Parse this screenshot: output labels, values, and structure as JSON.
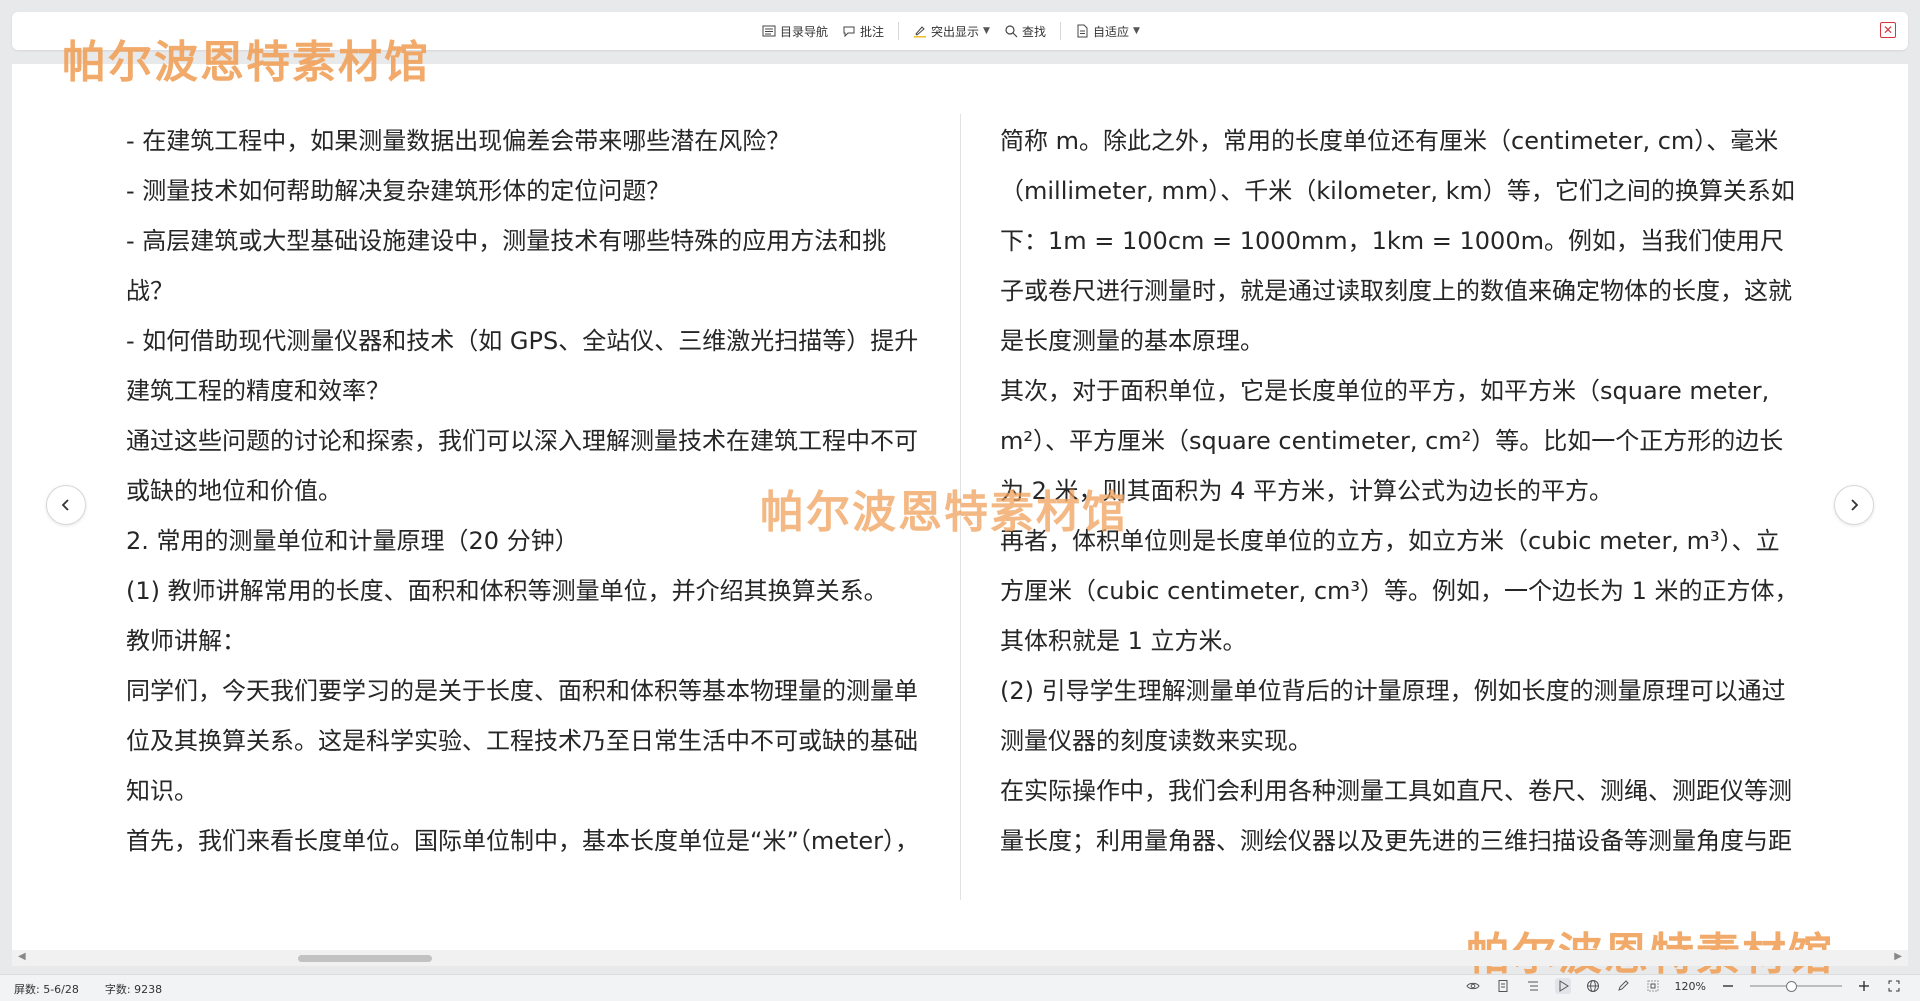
{
  "watermark": "帕尔波恩特素材馆",
  "toolbar": {
    "toc_label": "目录导航",
    "comment_label": "批注",
    "highlight_label": "突出显示",
    "find_label": "查找",
    "fit_label": "自适应"
  },
  "left_column": [
    "- 在建筑工程中，如果测量数据出现偏差会带来哪些潜在风险？",
    "- 测量技术如何帮助解决复杂建筑形体的定位问题？",
    "- 高层建筑或大型基础设施建设中，测量技术有哪些特殊的应用方法和挑战？",
    "- 如何借助现代测量仪器和技术（如 GPS、全站仪、三维激光扫描等）提升建筑工程的精度和效率？",
    "通过这些问题的讨论和探索，我们可以深入理解测量技术在建筑工程中不可或缺的地位和价值。",
    "2. 常用的测量单位和计量原理（20 分钟）",
    "(1) 教师讲解常用的长度、面积和体积等测量单位，并介绍其换算关系。",
    "教师讲解：",
    "同学们，今天我们要学习的是关于长度、面积和体积等基本物理量的测量单位及其换算关系。这是科学实验、工程技术乃至日常生活中不可或缺的基础知识。",
    "首先，我们来看长度单位。国际单位制中，基本长度单位是“米”（meter），"
  ],
  "right_column": [
    "简称 m。除此之外，常用的长度单位还有厘米（centimeter, cm）、毫米（millimeter, mm）、千米（kilometer, km）等，它们之间的换算关系如下：1m = 100cm = 1000mm，1km = 1000m。例如，当我们使用尺子或卷尺进行测量时，就是通过读取刻度上的数值来确定物体的长度，这就是长度测量的基本原理。",
    "其次，对于面积单位，它是长度单位的平方，如平方米（square meter, m²）、平方厘米（square centimeter, cm²）等。比如一个正方形的边长为 2 米，则其面积为 4 平方米，计算公式为边长的平方。",
    "再者，体积单位则是长度单位的立方，如立方米（cubic meter, m³）、立方厘米（cubic centimeter, cm³）等。例如，一个边长为 1 米的正方体，其体积就是 1 立方米。",
    "(2) 引导学生理解测量单位背后的计量原理，例如长度的测量原理可以通过测量仪器的刻度读数来实现。",
    "在实际操作中，我们会利用各种测量工具如直尺、卷尺、测绳、测距仪等测量长度；利用量角器、测绘仪器以及更先进的三维扫描设备等测量角度与距"
  ],
  "status": {
    "screen_label": "屏数: 5-6/28",
    "word_count_label": "字数: 9238",
    "zoom_label": "120%",
    "zoom_level_fraction": 0.45
  },
  "colors": {
    "watermark": "#f0a15a",
    "close_red": "#d9363e",
    "background": "#e8e9eb"
  }
}
